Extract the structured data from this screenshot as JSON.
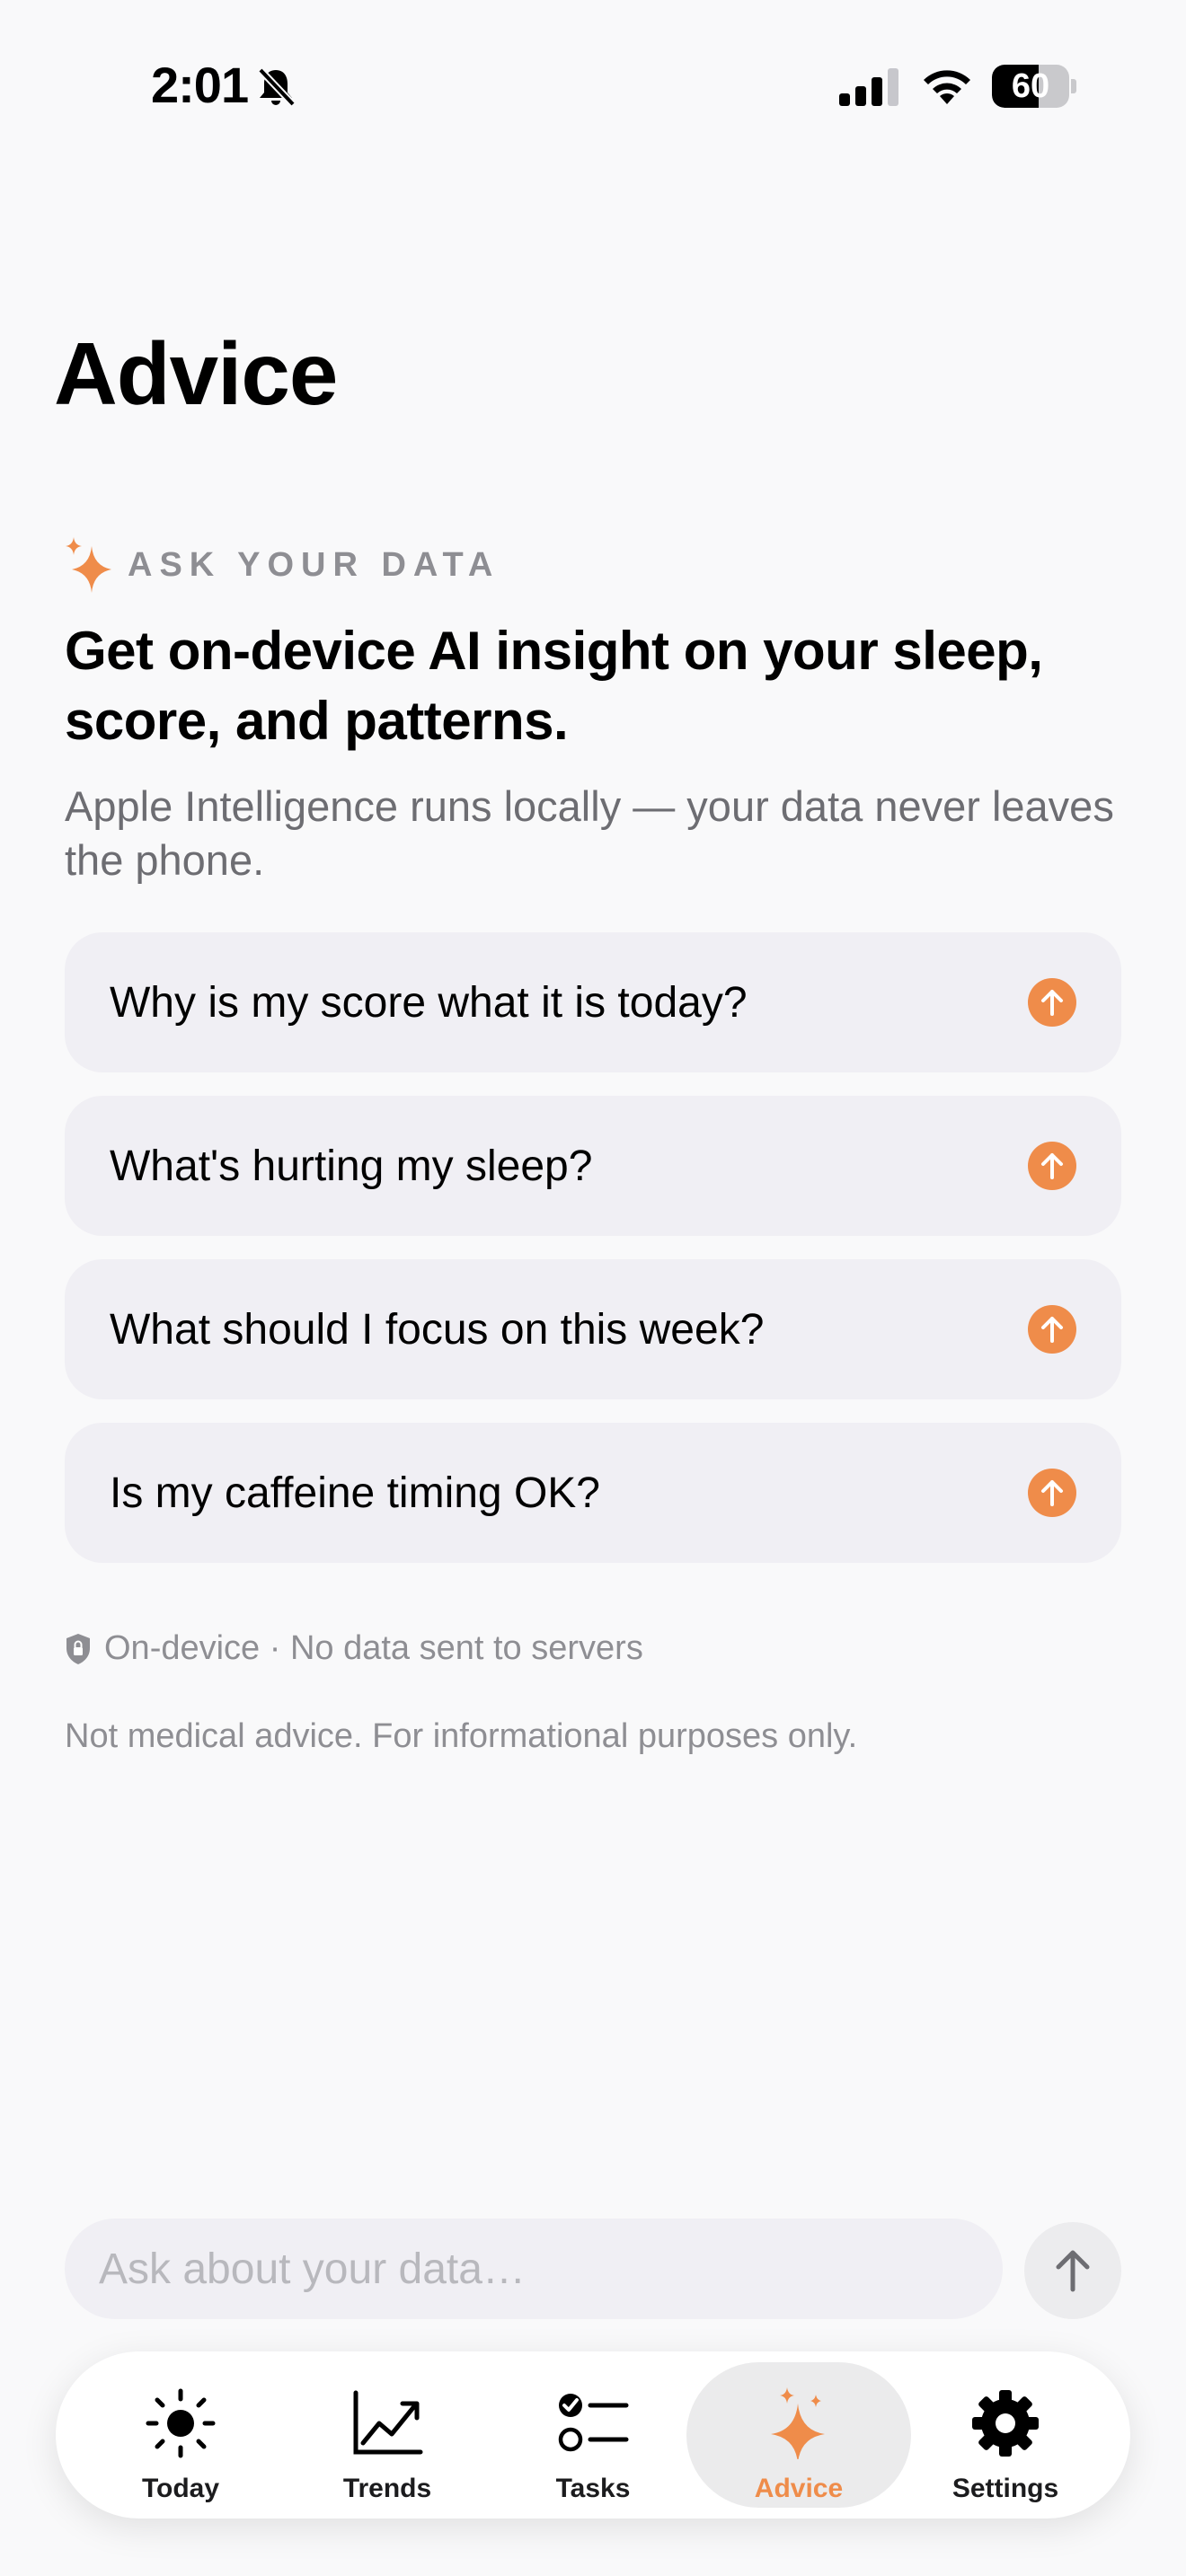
{
  "status_bar": {
    "time": "2:01",
    "battery": "60",
    "battery_level": 0.6
  },
  "page": {
    "title": "Advice"
  },
  "ask_section": {
    "label": "ASK YOUR DATA",
    "headline": "Get on-device AI insight on your sleep, score, and patterns.",
    "subtext": "Apple Intelligence runs locally — your data never leaves the phone."
  },
  "prompts": [
    {
      "text": "Why is my score what it is today?"
    },
    {
      "text": "What's hurting my sleep?"
    },
    {
      "text": "What should I focus on this week?"
    },
    {
      "text": "Is my caffeine timing OK?"
    }
  ],
  "privacy_note": "On-device · No data sent to servers",
  "disclaimer": "Not medical advice. For informational purposes only.",
  "composer": {
    "placeholder": "Ask about your data…"
  },
  "tabs": [
    {
      "label": "Today",
      "icon": "sun-icon"
    },
    {
      "label": "Trends",
      "icon": "chart-line-icon"
    },
    {
      "label": "Tasks",
      "icon": "checklist-icon"
    },
    {
      "label": "Advice",
      "icon": "sparkles-icon",
      "active": true
    },
    {
      "label": "Settings",
      "icon": "gear-icon"
    }
  ],
  "colors": {
    "accent": "#ef8c4a",
    "background": "#f9f9fa",
    "card": "#f0eff4",
    "secondary_text": "#8e8e93"
  }
}
